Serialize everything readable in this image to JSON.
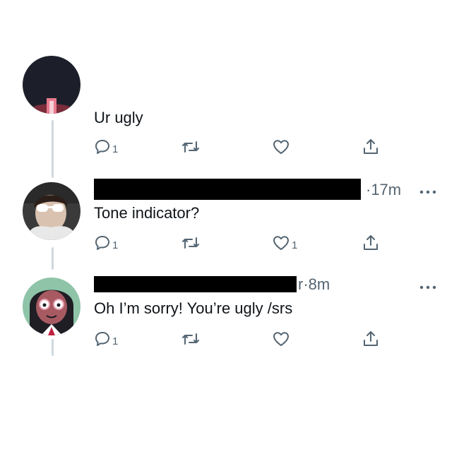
{
  "tweets": [
    {
      "text": "Ur ugly",
      "actions": {
        "reply_count": "1",
        "retweet_count": "",
        "like_count": ""
      }
    },
    {
      "time": "·17m",
      "text": "Tone indicator?",
      "actions": {
        "reply_count": "1",
        "retweet_count": "",
        "like_count": "1"
      }
    },
    {
      "time": "r·8m",
      "text": "Oh I’m sorry! You’re ugly /srs",
      "actions": {
        "reply_count": "1",
        "retweet_count": "",
        "like_count": ""
      }
    }
  ],
  "icons": {
    "reply": "reply-icon",
    "retweet": "retweet-icon",
    "like": "heart-icon",
    "share": "share-icon",
    "more": "more-dots-icon"
  },
  "colors": {
    "icon": "#536471",
    "thread_line": "#cfd9de",
    "redaction": "#000000"
  }
}
